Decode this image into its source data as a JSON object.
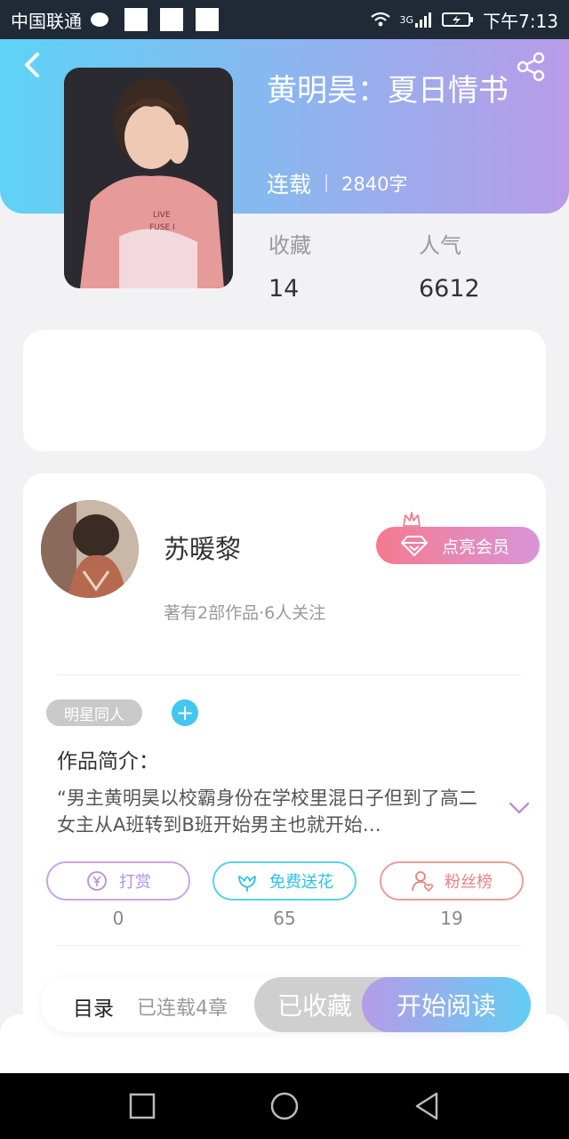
{
  "status_bar": {
    "carrier": "中国联通",
    "network": "3G",
    "time": "下午7:13"
  },
  "book": {
    "title": "黄明昊：夏日情书",
    "status": "连载",
    "word_count": "2840字",
    "stats": [
      {
        "label": "收藏",
        "value": "14"
      },
      {
        "label": "人气",
        "value": "6612"
      }
    ]
  },
  "author": {
    "name": "苏暖黎",
    "meta": "著有2部作品·6人关注",
    "vip_button": "点亮会员"
  },
  "tag": "明星同人",
  "intro": {
    "heading": "作品简介：",
    "text": "“男主黄明昊以校霸身份在学校里混日子但到了高二女主从A班转到B班开始男主也就开始…"
  },
  "actions": [
    {
      "label": "打赏",
      "count": "0"
    },
    {
      "label": "免费送花",
      "count": "65"
    },
    {
      "label": "粉丝榜",
      "count": "19"
    }
  ],
  "bottom_bar": {
    "catalog": "目录",
    "chapters": "已连载4章",
    "collected": "已收藏",
    "read": "开始阅读"
  },
  "colors": {
    "header_start": "#5ed3f6",
    "header_end": "#b99be8",
    "accent_blue": "#43c7ee",
    "vip_pink": "#f57a90"
  },
  "icons": [
    "back-icon",
    "share-icon",
    "crown-icon",
    "diamond-icon",
    "plus-icon",
    "chevron-down-icon",
    "yen-icon",
    "flower-icon",
    "fans-icon",
    "nav-square-icon",
    "nav-circle-icon",
    "nav-back-icon"
  ]
}
